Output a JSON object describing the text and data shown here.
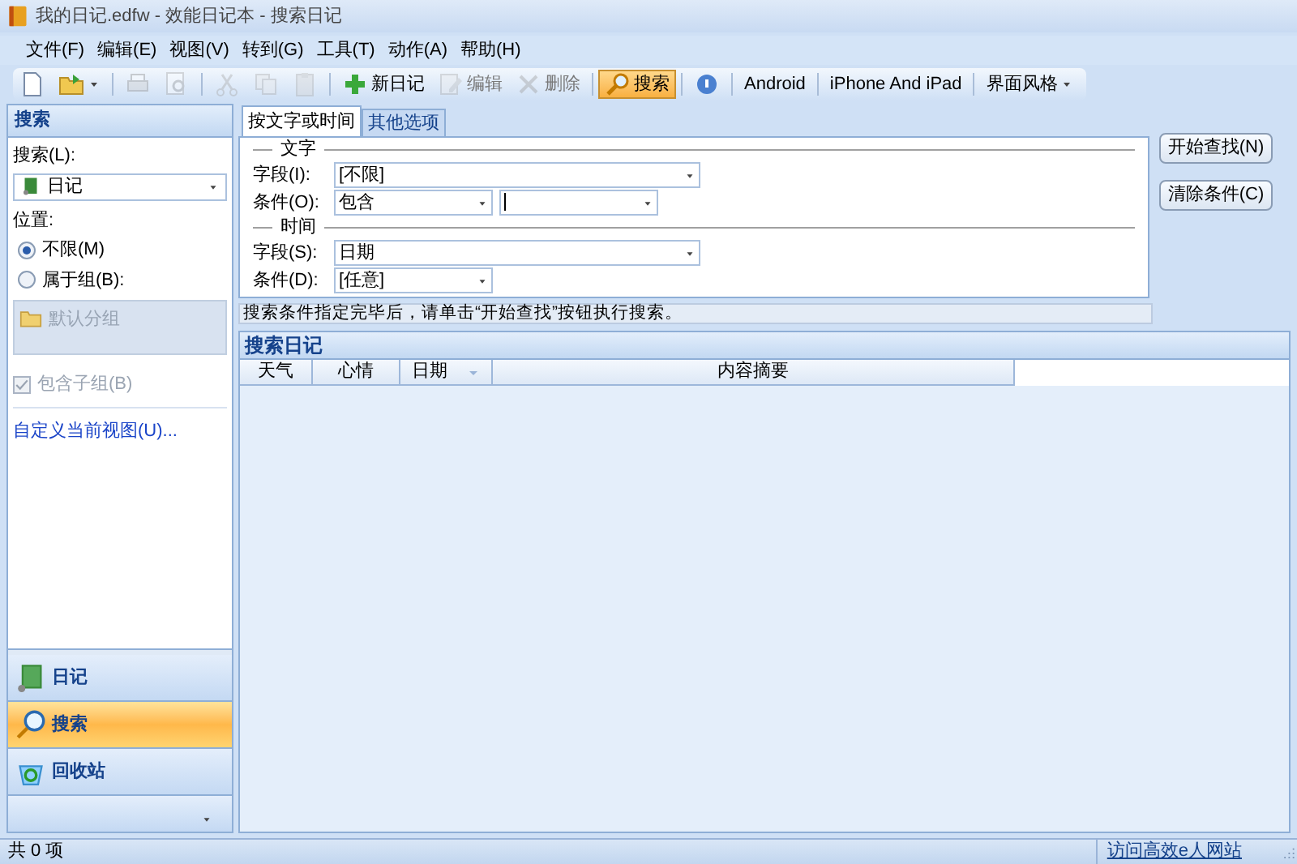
{
  "window": {
    "title": "我的日记.edfw - 效能日记本 - 搜索日记"
  },
  "menu": [
    "文件(F)",
    "编辑(E)",
    "视图(V)",
    "转到(G)",
    "工具(T)",
    "动作(A)",
    "帮助(H)"
  ],
  "toolbar": [
    [
      {
        "disabled": false,
        "selected": false,
        "dropdown": false
      },
      {
        "disabled": false,
        "selected": false,
        "dropdown": true
      }
    ],
    [
      {
        "disabled": true,
        "selected": false,
        "dropdown": false
      },
      {
        "disabled": true,
        "selected": false,
        "dropdown": false
      }
    ],
    [
      {
        "disabled": true,
        "selected": false,
        "dropdown": false
      },
      {
        "disabled": true,
        "selected": false,
        "dropdown": false
      },
      {
        "disabled": true,
        "selected": false,
        "dropdown": false
      }
    ],
    [
      {
        "label": "新日记",
        "disabled": false,
        "selected": false,
        "dropdown": false
      },
      {
        "label": "编辑",
        "disabled": true,
        "selected": false,
        "dropdown": false
      },
      {
        "label": "删除",
        "disabled": true,
        "selected": false,
        "dropdown": false
      }
    ],
    [
      {
        "label": "搜索",
        "disabled": false,
        "selected": true,
        "dropdown": false
      }
    ],
    [
      {
        "disabled": false,
        "selected": false,
        "dropdown": false
      }
    ],
    [
      {
        "label": "Android",
        "disabled": false,
        "selected": false,
        "dropdown": false
      }
    ],
    [
      {
        "label": "iPhone And iPad",
        "disabled": false,
        "selected": false,
        "dropdown": false
      }
    ],
    [
      {
        "label": "界面风格",
        "disabled": false,
        "selected": false,
        "dropdown": true
      }
    ]
  ],
  "sidebar": {
    "title": "搜索",
    "search_label": "搜索(L):",
    "search_value": "日记",
    "location_label": "位置:",
    "radios": [
      {
        "label": "不限(M)",
        "selected": true
      },
      {
        "label": "属于组(B):",
        "selected": false
      }
    ],
    "groups": {
      "disabled": true,
      "items": [
        "默认分组"
      ]
    },
    "include_subgroups": {
      "label": "包含子组(B)",
      "checked": true,
      "disabled": true
    },
    "link": "自定义当前视图(U)...",
    "nav": [
      {
        "label": "日记",
        "selected": false
      },
      {
        "label": "搜索",
        "selected": true
      },
      {
        "label": "回收站",
        "selected": false
      }
    ]
  },
  "tabs": [
    {
      "label": "按文字或时间",
      "selected": true
    },
    {
      "label": "其他选项",
      "selected": false
    }
  ],
  "sections": [
    {
      "title": "文字",
      "rows": [
        {
          "label": "字段(I):",
          "fields": [
            {
              "value": "[不限]",
              "wide": true
            }
          ]
        },
        {
          "label": "条件(O):",
          "fields": [
            {
              "value": "包含",
              "wide": false
            },
            {
              "wide": false,
              "cursor": true
            }
          ]
        }
      ]
    },
    {
      "title": "时间",
      "rows": [
        {
          "label": "字段(S):",
          "fields": [
            {
              "value": "日期",
              "wide": true
            }
          ]
        },
        {
          "label": "条件(D):",
          "fields": [
            {
              "value": "[任意]",
              "wide": false
            }
          ]
        }
      ]
    }
  ],
  "buttons": [
    "开始查找(N)",
    "清除条件(C)"
  ],
  "hint": "搜索条件指定完毕后，请单击“开始查找”按钮执行搜索。",
  "results": {
    "title": "搜索日记",
    "columns": [
      {
        "label": "天气",
        "sorted": false
      },
      {
        "label": "心情",
        "sorted": false
      },
      {
        "label": "日期",
        "sorted": true
      },
      {
        "label": "内容摘要",
        "sorted": false
      }
    ]
  },
  "status_bar": {
    "count": "共 0 项",
    "link": "访问高效e人网站"
  }
}
